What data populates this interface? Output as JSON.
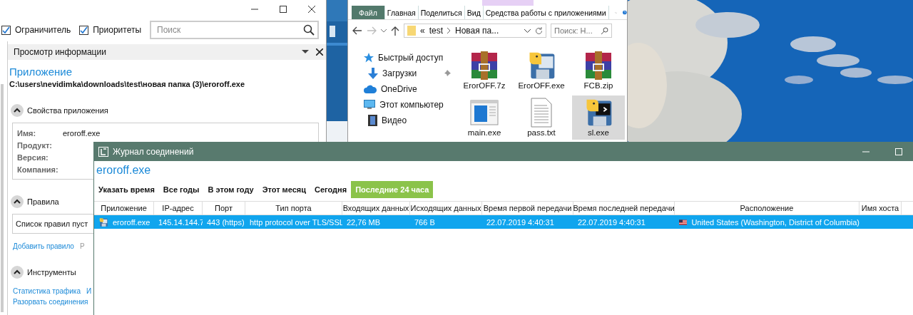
{
  "app_window": {
    "filters": [
      {
        "label": "Ограничитель",
        "checked": true
      },
      {
        "label": "Приоритеты",
        "checked": true
      }
    ],
    "search": {
      "placeholder": "Поиск"
    },
    "info_panel": {
      "title": "Просмотр информации",
      "heading": "Приложение",
      "path": "C:\\users\\nevidimka\\downloads\\test\\новая папка (3)\\eroroff.exe",
      "sections": [
        {
          "title": "Свойства приложения",
          "expanded": true,
          "kind": "properties",
          "properties": [
            {
              "label": "Имя:",
              "value": "eroroff.exe"
            },
            {
              "label": "Продукт:"
            },
            {
              "label": "Версия:"
            },
            {
              "label": "Компания:"
            }
          ]
        },
        {
          "title": "Правила",
          "expanded": true,
          "kind": "rules",
          "note": "Список правил пуст",
          "link_rows": [
            [
              {
                "label": "Добавить правило",
                "disabled": false
              },
              {
                "label": "Р",
                "disabled": true
              }
            ]
          ]
        },
        {
          "title": "Инструменты",
          "expanded": true,
          "kind": "tools",
          "link_rows": [
            [
              {
                "label": "Статистика трафика",
                "disabled": false
              },
              {
                "label": "И",
                "disabled": false
              }
            ],
            [
              {
                "label": "Разорвать соединения",
                "disabled": false
              }
            ]
          ]
        }
      ]
    }
  },
  "explorer": {
    "ribbon_tabs": [
      {
        "label": "Файл",
        "kind": "file"
      },
      {
        "label": "Главная",
        "kind": "tab"
      },
      {
        "label": "Поделиться",
        "kind": "tab"
      },
      {
        "label": "Вид",
        "kind": "tab"
      },
      {
        "label": "Средства работы с приложениями",
        "kind": "context"
      }
    ],
    "address": {
      "overflow": "«",
      "crumbs": [
        "test",
        "Новая па..."
      ]
    },
    "search": {
      "placeholder": "Поиск: Н..."
    },
    "nav": [
      {
        "label": "Быстрый доступ",
        "kind": "star",
        "pinned": false,
        "children": [
          {
            "label": "Загрузки",
            "kind": "download",
            "pinned": true
          }
        ]
      },
      {
        "label": "OneDrive",
        "kind": "cloud",
        "pinned": false
      },
      {
        "label": "Этот компьютер",
        "kind": "computer",
        "pinned": false,
        "children": [
          {
            "label": "Видео",
            "kind": "video",
            "pinned": false
          }
        ]
      }
    ],
    "files": [
      {
        "name": "ErorOFF.7z",
        "kind": "archive",
        "selected": false
      },
      {
        "name": "ErorOFF.exe",
        "kind": "python",
        "selected": false
      },
      {
        "name": "FCB.zip",
        "kind": "archive",
        "selected": false
      },
      {
        "name": "main.exe",
        "kind": "app",
        "selected": false
      },
      {
        "name": "pass.txt",
        "kind": "text",
        "selected": false
      },
      {
        "name": "sl.exe",
        "kind": "console",
        "selected": true
      }
    ]
  },
  "connections_window": {
    "title": "Журнал соединений",
    "app": "eroroff.exe",
    "periods": [
      {
        "label": "Указать время",
        "selected": false
      },
      {
        "label": "Все годы",
        "selected": false
      },
      {
        "label": "В этом году",
        "selected": false
      },
      {
        "label": "Этот месяц",
        "selected": false
      },
      {
        "label": "Сегодня",
        "selected": false
      },
      {
        "label": "Последние 24 часа",
        "selected": true
      }
    ],
    "table": {
      "columns": [
        "Приложение",
        "IP-адрес",
        "Порт",
        "Тип порта",
        "Входящих данных",
        "Исходящих данных",
        "Время первой передачи",
        "Время последней передачи",
        "Расположение",
        "Имя хоста"
      ],
      "rows": [
        {
          "selected": true,
          "cells": [
            "eroroff.exe",
            "145.14.144.7",
            "443 (https)",
            "http protocol over TLS/SSL",
            "22,76 MB",
            "766 B",
            "22.07.2019 4:40:31",
            "22.07.2019 4:40:31",
            "United States (Washington, District of Columbia)"
          ]
        }
      ]
    }
  }
}
